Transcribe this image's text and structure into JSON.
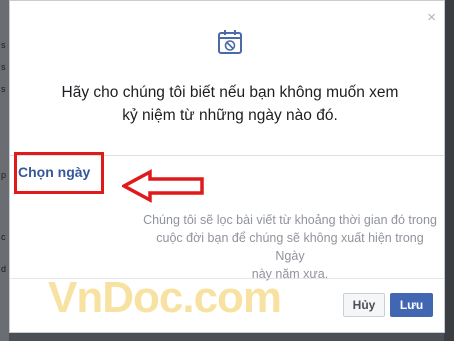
{
  "background": {
    "left_fragments": [
      "s",
      "s",
      "s",
      "p",
      "c",
      "d"
    ]
  },
  "dialog": {
    "close_glyph": "×",
    "icon": "calendar-block-icon",
    "headline_line1": "Hãy cho chúng tôi biết nếu bạn không muốn xem",
    "headline_line2": "kỷ niệm từ những ngày nào đó.",
    "choose_dates_label": "Chọn ngày",
    "description_line1": "Chúng tôi sẽ lọc bài viết từ khoảng thời gian đó trong",
    "description_line2": "cuộc đời bạn để chúng sẽ không xuất hiện trong Ngày",
    "description_line3": "này năm xưa.",
    "cancel_label": "Hủy",
    "save_label": "Lưu"
  },
  "watermark": {
    "text": "VnDoc.com"
  },
  "colors": {
    "accent": "#4267b2",
    "link": "#365899",
    "highlight_red": "#e01a1a",
    "watermark": "#f0bf33"
  }
}
